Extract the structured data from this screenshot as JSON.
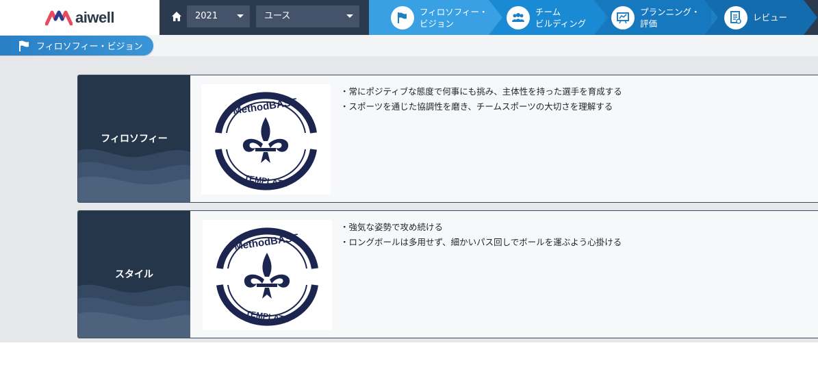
{
  "app": {
    "logo_text": "aiwell"
  },
  "filters": {
    "year": "2021",
    "team": "ユース"
  },
  "steps": [
    {
      "label": "フィロソフィー・\nビジョン",
      "icon": "flag-icon",
      "active": true
    },
    {
      "label": "チーム\nビルディング",
      "icon": "team-icon",
      "active": false
    },
    {
      "label": "プランニング・\n評価",
      "icon": "planning-icon",
      "active": false
    },
    {
      "label": "レビュー",
      "icon": "review-icon",
      "active": false
    }
  ],
  "breadcrumb": {
    "label": "フィロソフィー・ビジョン",
    "icon": "flag-icon"
  },
  "sections": [
    {
      "title": "フィロソフィー",
      "logo_text_top": "MethodBASE",
      "logo_text_bottom": "TEMPLATE",
      "bullets": [
        "・常にポジティブな態度で何事にも挑み、主体性を持った選手を育成する",
        "・スポーツを通じた協調性を磨き、チームスポーツの大切さを理解する"
      ]
    },
    {
      "title": "スタイル",
      "logo_text_top": "MethodBASE",
      "logo_text_bottom": "TEMPLATE",
      "bullets": [
        "・強気な姿勢で攻め続ける",
        "・ロングボールは多用せず、細かいパス回しでボールを運ぶよう心掛ける"
      ]
    }
  ],
  "colors": {
    "nav_dark": "#2b3a4f",
    "step_active": "#3aa0e4",
    "step_base": "#1f7fc3",
    "card_side": "#25364b",
    "emblem": "#1c2450"
  }
}
